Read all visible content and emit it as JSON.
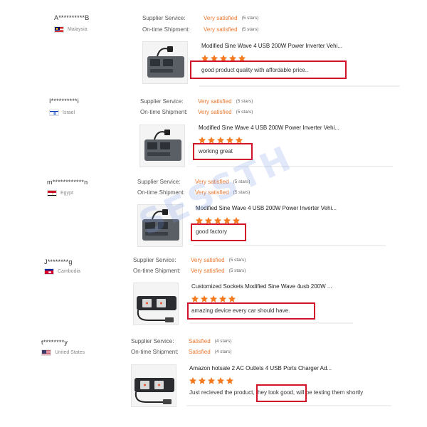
{
  "labels": {
    "supplier_service": "Supplier Service:",
    "ontime_shipment": "On-time Shipment:"
  },
  "watermark": "SESSTH",
  "colors": {
    "rating_text": "#e8772e",
    "star": "#f47a20",
    "highlight_box": "#d2142a"
  },
  "reviews": [
    {
      "user": "A**********B",
      "country": "Malaysia",
      "flag": "malaysia-flag-icon",
      "supplier_service": "Very satisfied",
      "supplier_service_stars": "(5 stars)",
      "ontime_shipment": "Very satisfied",
      "ontime_shipment_stars": "(5 stars)",
      "product_title": "Modified Sine Wave 4 USB 200W Power Inverter Vehi...",
      "rating": 5,
      "comment": "good product quality with affordable price..",
      "product_image": "power-inverter-image"
    },
    {
      "user": "I**********i",
      "country": "Israel",
      "flag": "israel-flag-icon",
      "supplier_service": "Very satisfied",
      "supplier_service_stars": "(5 stars)",
      "ontime_shipment": "Very satisfied",
      "ontime_shipment_stars": "(5 stars)",
      "product_title": "Modified Sine Wave 4 USB 200W Power Inverter Vehi...",
      "rating": 5,
      "comment": "working great",
      "product_image": "power-inverter-image"
    },
    {
      "user": "m************n",
      "country": "Egypt",
      "flag": "egypt-flag-icon",
      "supplier_service": "Very satisfied",
      "supplier_service_stars": "(5 stars)",
      "ontime_shipment": "Very satisfied",
      "ontime_shipment_stars": "(5 stars)",
      "product_title": "Modified Sine Wave 4 USB 200W Power Inverter Vehi...",
      "rating": 5,
      "comment": "good factory",
      "product_image": "power-inverter-image"
    },
    {
      "user": "J********g",
      "country": "Cambodia",
      "flag": "cambodia-flag-icon",
      "supplier_service": "Very satisfied",
      "supplier_service_stars": "(5 stars)",
      "ontime_shipment": "Very satisfied",
      "ontime_shipment_stars": "(5 stars)",
      "product_title": "Customized Sockets Modified Sine Wave 4usb 200W ...",
      "rating": 5,
      "comment": "amazing device every car should have.",
      "product_image": "socket-inverter-image"
    },
    {
      "user": "t********y",
      "country": "United States",
      "flag": "united-states-flag-icon",
      "supplier_service": "Satisfied",
      "supplier_service_stars": "(4 stars)",
      "ontime_shipment": "Satisfied",
      "ontime_shipment_stars": "(4 stars)",
      "product_title": "Amazon hotsale 2 AC Outlets 4 USB Ports Charger Ad...",
      "rating": 5,
      "comment": "Just recieved the product, they look good, will be testing them shortly",
      "product_image": "socket-inverter-image"
    }
  ]
}
